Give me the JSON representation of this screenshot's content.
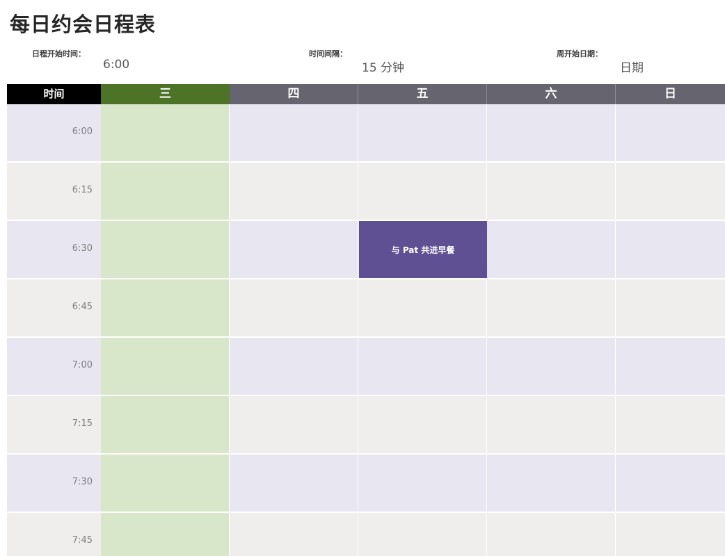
{
  "title": "每日约会日程表",
  "settings": {
    "start_time_label": "日程开始时间：",
    "start_time_value": "6:00",
    "interval_label": "时间间隔：",
    "interval_value": "15 分钟",
    "week_start_label": "周开始日期：",
    "week_start_value": "日期"
  },
  "header": {
    "time_label": "时间",
    "days": [
      "三",
      "四",
      "五",
      "六",
      "日"
    ]
  },
  "times": [
    "6:00",
    "6:15",
    "6:30",
    "6:45",
    "7:00",
    "7:15",
    "7:30",
    "7:45"
  ],
  "event": {
    "label": "与 Pat 共进早餐",
    "day": "五",
    "time": "6:30"
  },
  "colors": {
    "header_time_bg": "#000000",
    "header_day_bg": "#65646f",
    "header_active_bg": "#4d7327",
    "active_column_bg": "#d8e7c9",
    "row_alt_a": "#e7e6f1",
    "row_alt_b": "#efeeed",
    "event_bg": "#5f5094"
  }
}
